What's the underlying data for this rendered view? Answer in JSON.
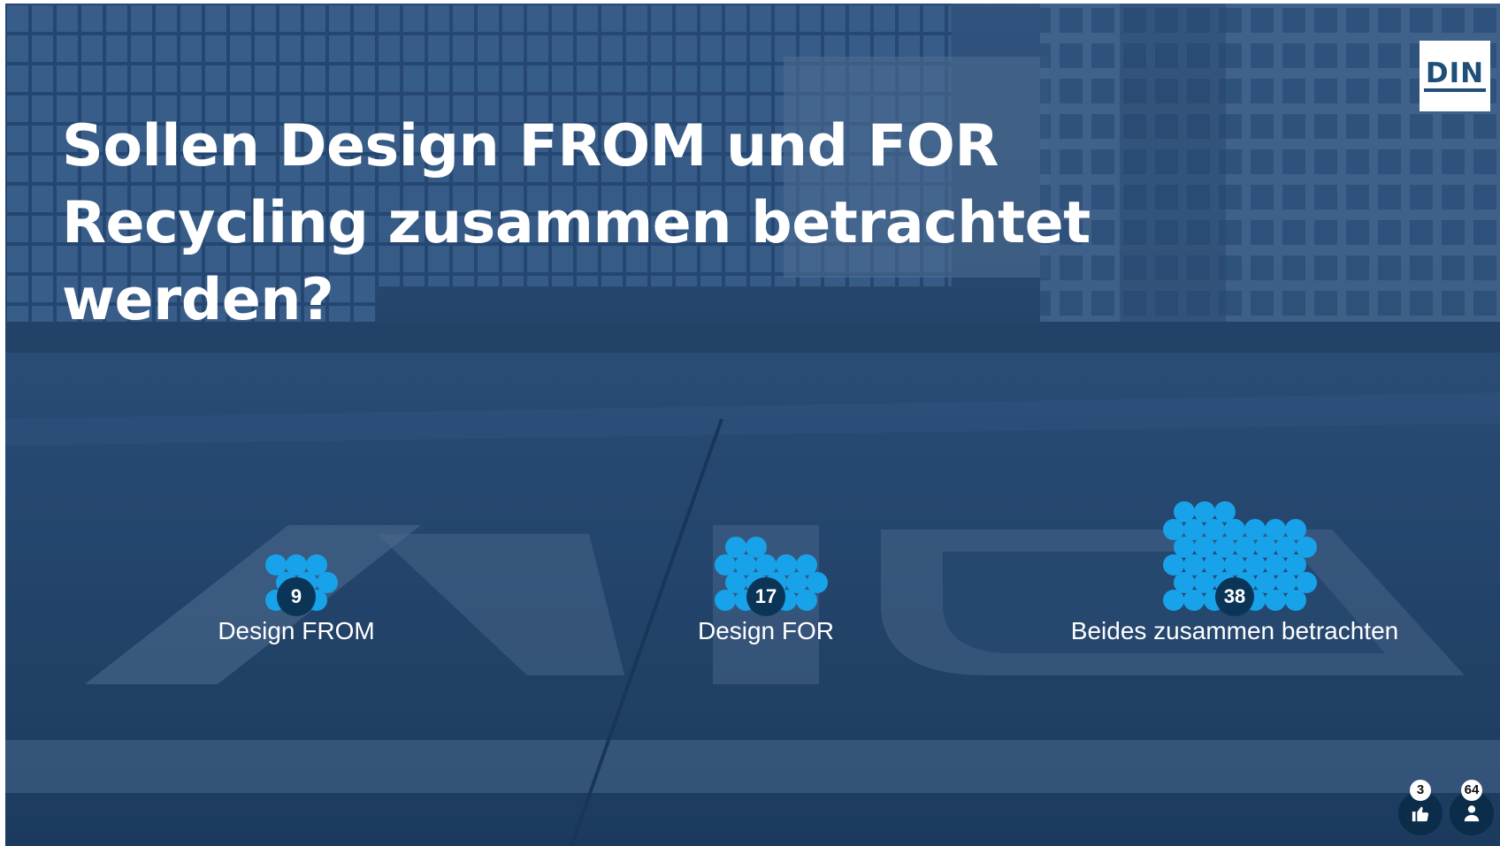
{
  "slide": {
    "title": "Sollen Design FROM und FOR Recycling zusammen betrachtet werden?",
    "logo_text": "DIN",
    "accent_color": "#17a2ea",
    "count_badge_color": "#0b3557"
  },
  "results": [
    {
      "label": "Design FROM",
      "votes": 9
    },
    {
      "label": "Design FOR",
      "votes": 17
    },
    {
      "label": "Beides zusammen betrachten",
      "votes": 38
    }
  ],
  "footer": {
    "likes": {
      "icon": "thumbs-up-icon",
      "count": 3
    },
    "participants": {
      "icon": "person-icon",
      "count": 64
    }
  }
}
